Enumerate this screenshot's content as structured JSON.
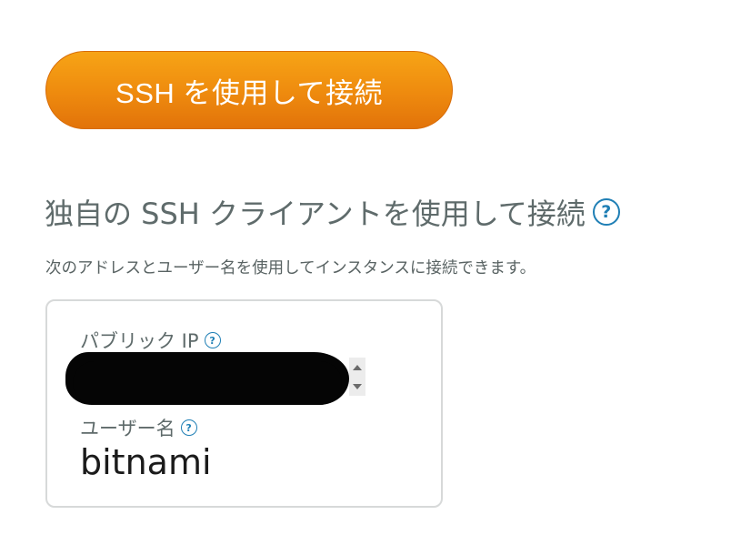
{
  "connect_button": {
    "label": "SSH を使用して接続"
  },
  "ssh_client_section": {
    "heading": "独自の SSH クライアントを使用して接続",
    "help_icon": "?",
    "description": "次のアドレスとユーザー名を使用してインスタンスに接続できます。"
  },
  "connection_card": {
    "public_ip": {
      "label": "パブリック IP",
      "help_icon": "?",
      "value": ""
    },
    "username": {
      "label": "ユーザー名",
      "help_icon": "?",
      "value": "bitnami"
    }
  },
  "colors": {
    "button_orange": "#ee8a0e",
    "help_blue": "#1f7fb5",
    "heading_gray": "#5f6b6b"
  }
}
